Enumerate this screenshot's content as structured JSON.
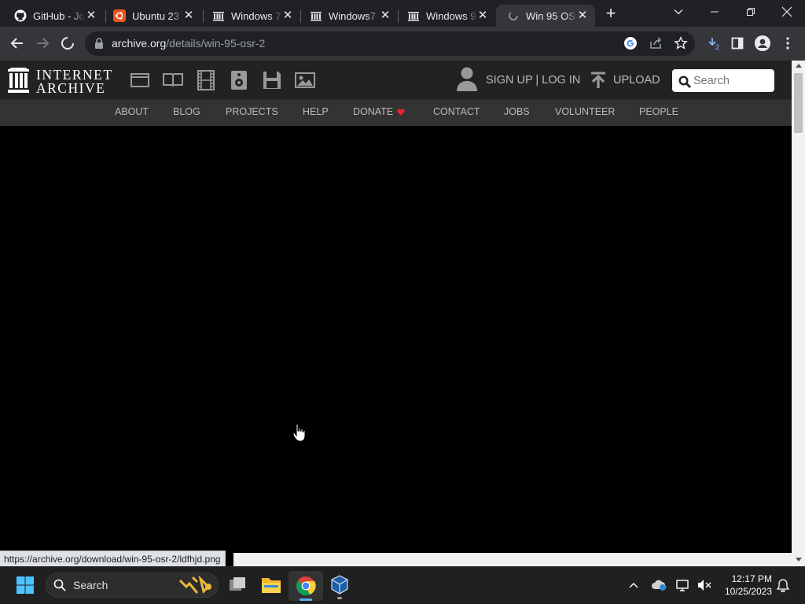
{
  "browser": {
    "tabs": [
      {
        "title": "GitHub - Jo",
        "icon": "github-icon",
        "active": false
      },
      {
        "title": "Ubuntu 23",
        "icon": "ubuntu-icon",
        "active": false
      },
      {
        "title": "Windows 7",
        "icon": "internet-archive-icon",
        "active": false
      },
      {
        "title": "Windows7",
        "icon": "internet-archive-icon",
        "active": false
      },
      {
        "title": "Windows 9",
        "icon": "internet-archive-icon",
        "active": false
      },
      {
        "title": "Win 95 OS",
        "icon": "loading-icon",
        "active": true
      }
    ],
    "new_tab_label": "+",
    "url_host": "archive.org",
    "url_path": "/details/win-95-osr-2",
    "download_count": "2",
    "status_url": "https://archive.org/download/win-95-osr-2/ldfhjd.png"
  },
  "ia": {
    "logo_line1": "INTERNET",
    "logo_line2": "ARCHIVE",
    "media_icons": [
      "web-icon",
      "texts-icon",
      "video-icon",
      "audio-icon",
      "software-icon",
      "images-icon"
    ],
    "signup_login": "SIGN UP | LOG IN",
    "upload": "UPLOAD",
    "search_placeholder": "Search",
    "nav": [
      "ABOUT",
      "BLOG",
      "PROJECTS",
      "HELP",
      "DONATE",
      "CONTACT",
      "JOBS",
      "VOLUNTEER",
      "PEOPLE"
    ]
  },
  "taskbar": {
    "search_placeholder": "Search",
    "time": "12:17 PM",
    "date": "10/25/2023",
    "apps": [
      "start-icon",
      "task-view-icon",
      "file-explorer-icon",
      "chrome-icon",
      "virtualbox-icon"
    ]
  },
  "colors": {
    "accent_red": "#e8242f",
    "ia_header": "#222222",
    "ia_nav": "#333333"
  }
}
